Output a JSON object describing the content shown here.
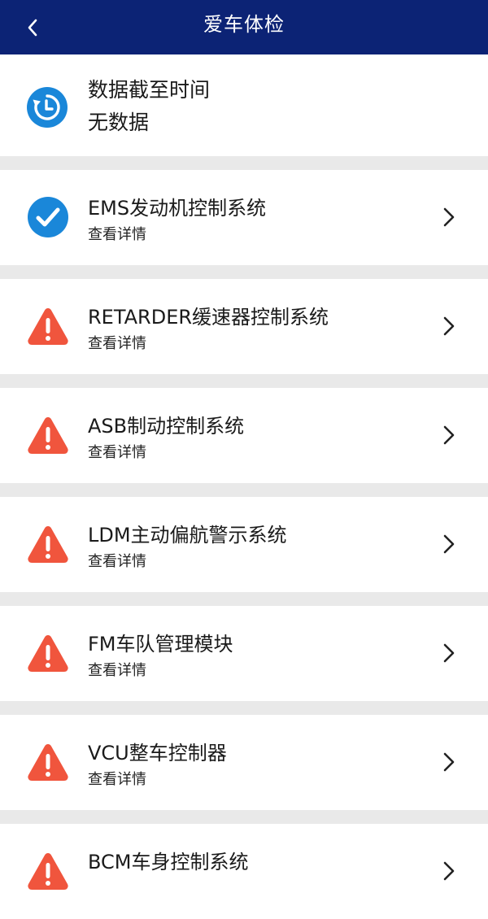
{
  "header": {
    "title": "爱车体检",
    "back_icon": "chevron-left-icon"
  },
  "data_time": {
    "icon": "clock-refresh-icon",
    "label": "数据截至时间",
    "value": "无数据"
  },
  "colors": {
    "header_bg": "#0c2375",
    "ok_blue": "#1a87d9",
    "warning_red": "#f0553d",
    "separator": "#e9e9e9"
  },
  "systems": [
    {
      "name": "EMS发动机控制系统",
      "link": "查看详情",
      "status": "ok",
      "icon": "check-circle-icon"
    },
    {
      "name": "RETARDER缓速器控制系统",
      "link": "查看详情",
      "status": "warning",
      "icon": "warning-triangle-icon"
    },
    {
      "name": "ASB制动控制系统",
      "link": "查看详情",
      "status": "warning",
      "icon": "warning-triangle-icon"
    },
    {
      "name": "LDM主动偏航警示系统",
      "link": "查看详情",
      "status": "warning",
      "icon": "warning-triangle-icon"
    },
    {
      "name": "FM车队管理模块",
      "link": "查看详情",
      "status": "warning",
      "icon": "warning-triangle-icon"
    },
    {
      "name": "VCU整车控制器",
      "link": "查看详情",
      "status": "warning",
      "icon": "warning-triangle-icon"
    },
    {
      "name": "BCM车身控制系统",
      "link": "",
      "status": "warning",
      "icon": "warning-triangle-icon"
    }
  ]
}
